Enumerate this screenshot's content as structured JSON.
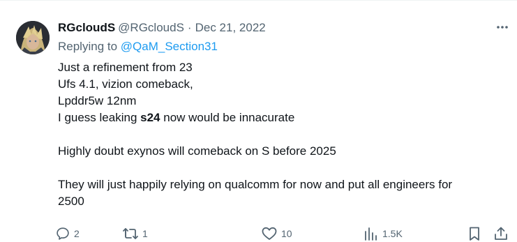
{
  "tweet": {
    "display_name": "RGcloudS",
    "handle": "@RGcloudS",
    "separator": "·",
    "date": "Dec 21, 2022",
    "replying_prefix": "Replying to ",
    "replying_to": "@QaM_Section31",
    "lines": [
      "Just a refinement from 23",
      "Ufs 4.1, vizion comeback,",
      "Lpddr5w 12nm"
    ],
    "line4_before": "I guess leaking ",
    "line4_bold": "s24",
    "line4_after": " now would be innacurate",
    "paragraph2": "Highly doubt exynos will comeback on S before 2025",
    "paragraph3_line1": "They will just happily relying on qualcomm for now and put all engineers for",
    "paragraph3_line2": "2500"
  },
  "actions": {
    "replies": "2",
    "reposts": "1",
    "likes": "10",
    "views": "1.5K"
  },
  "colors": {
    "text": "#0f1419",
    "secondary": "#536471",
    "accent": "#1d9bf0",
    "border": "#eff3f4"
  },
  "icons": {
    "more": "more-icon",
    "reply": "reply-icon",
    "repost": "repost-icon",
    "like": "like-icon",
    "views": "views-icon",
    "bookmark": "bookmark-icon",
    "share": "share-icon"
  }
}
